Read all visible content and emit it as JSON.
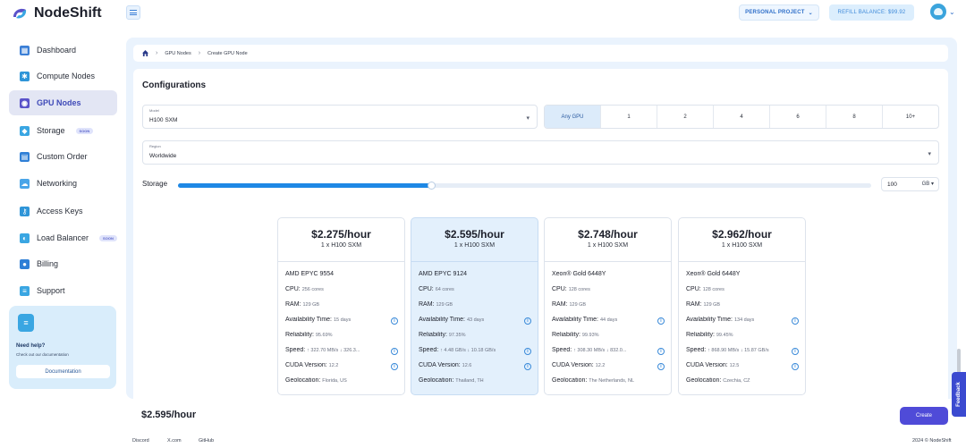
{
  "app": {
    "name": "NodeShift"
  },
  "header": {
    "project_label": "PERSONAL PROJECT",
    "refill_label": "REFILL BALANCE: $99.92"
  },
  "sidebar": {
    "items": [
      {
        "label": "Dashboard",
        "icon": "dashboard-icon",
        "color": "#3b7fd6"
      },
      {
        "label": "Compute Nodes",
        "icon": "chip-icon",
        "color": "#2f95d8"
      },
      {
        "label": "GPU Nodes",
        "icon": "gpu-icon",
        "color": "#5a52c9",
        "active": true
      },
      {
        "label": "Storage",
        "icon": "storage-icon",
        "color": "#3aa6e2",
        "badge": "SOON"
      },
      {
        "label": "Custom Order",
        "icon": "order-icon",
        "color": "#2f7fd6"
      },
      {
        "label": "Networking",
        "icon": "cloud-icon",
        "color": "#4aa5e8"
      },
      {
        "label": "Access Keys",
        "icon": "key-icon",
        "color": "#2f95d8"
      },
      {
        "label": "Load Balancer",
        "icon": "balance-icon",
        "color": "#3aa6e2",
        "badge": "SOON"
      },
      {
        "label": "Billing",
        "icon": "billing-icon",
        "color": "#2f7fd6"
      },
      {
        "label": "Support",
        "icon": "support-icon",
        "color": "#3aa6e2"
      }
    ],
    "help": {
      "title": "Need help?",
      "subtitle": "Check out our documentation",
      "button": "Documentation"
    }
  },
  "breadcrumb": {
    "items": [
      "GPU Nodes",
      "Create GPU Node"
    ]
  },
  "config": {
    "title": "Configurations",
    "model": {
      "label": "Model",
      "value": "H100 SXM"
    },
    "gpu_options": [
      "Any GPU",
      "1",
      "2",
      "4",
      "6",
      "8",
      "10+"
    ],
    "region": {
      "label": "Region",
      "value": "Worldwide"
    },
    "storage": {
      "label": "Storage",
      "value": "100",
      "unit": "GB",
      "fill_fraction": 0.365
    }
  },
  "plans": [
    {
      "price": "$2.275/hour",
      "count": "1 x H100 SXM",
      "cpu_name": "AMD EPYC 9554",
      "cpu_label": "CPU:",
      "cpu": "256 cores",
      "ram_label": "RAM:",
      "ram": "129 GB",
      "avail_label": "Availability Time:",
      "avail": "15 days",
      "rel_label": "Reliability:",
      "rel": "95.69%",
      "speed_label": "Speed:",
      "speed": "↑ 322.70 MB/s ↓ 326.3...",
      "cuda_label": "CUDA Version:",
      "cuda": "12.2",
      "geo_label": "Geolocation:",
      "geo": "Florida, US",
      "selected": false
    },
    {
      "price": "$2.595/hour",
      "count": "1 x H100 SXM",
      "cpu_name": "AMD EPYC 9124",
      "cpu_label": "CPU:",
      "cpu": "64 cores",
      "ram_label": "RAM:",
      "ram": "129 GB",
      "avail_label": "Availability Time:",
      "avail": "43 days",
      "rel_label": "Reliability:",
      "rel": "97.35%",
      "speed_label": "Speed:",
      "speed": "↑ 4.48 GB/s ↓ 10.18 GB/s",
      "cuda_label": "CUDA Version:",
      "cuda": "12.6",
      "geo_label": "Geolocation:",
      "geo": "Thailand, TH",
      "selected": true
    },
    {
      "price": "$2.748/hour",
      "count": "1 x H100 SXM",
      "cpu_name": "Xeon® Gold 6448Y",
      "cpu_label": "CPU:",
      "cpu": "128 cores",
      "ram_label": "RAM:",
      "ram": "129 GB",
      "avail_label": "Availability Time:",
      "avail": "44 days",
      "rel_label": "Reliability:",
      "rel": "99.93%",
      "speed_label": "Speed:",
      "speed": "↑ 308.30 MB/s ↓ 832.0...",
      "cuda_label": "CUDA Version:",
      "cuda": "12.2",
      "geo_label": "Geolocation:",
      "geo": "The Netherlands, NL",
      "selected": false
    },
    {
      "price": "$2.962/hour",
      "count": "1 x H100 SXM",
      "cpu_name": "Xeon® Gold 6448Y",
      "cpu_label": "CPU:",
      "cpu": "128 cores",
      "ram_label": "RAM:",
      "ram": "129 GB",
      "avail_label": "Availability Time:",
      "avail": "134 days",
      "rel_label": "Reliability:",
      "rel": "99.45%",
      "speed_label": "Speed:",
      "speed": "↑ 868.90 MB/s ↓ 15.87 GB/s",
      "cuda_label": "CUDA Version:",
      "cuda": "12.5",
      "geo_label": "Geolocation:",
      "geo": "Czechia, CZ",
      "selected": false
    }
  ],
  "summary": {
    "price": "$2.595/hour",
    "create_label": "Create"
  },
  "footer": {
    "links": [
      "Discord",
      "X.com",
      "GitHub"
    ],
    "copyright": "2024 © NodeShift"
  },
  "feedback_label": "Feedback",
  "colors": {
    "accent": "#4f4bd8",
    "primary": "#1e88e5",
    "selected_card": "#e3f0fc"
  }
}
